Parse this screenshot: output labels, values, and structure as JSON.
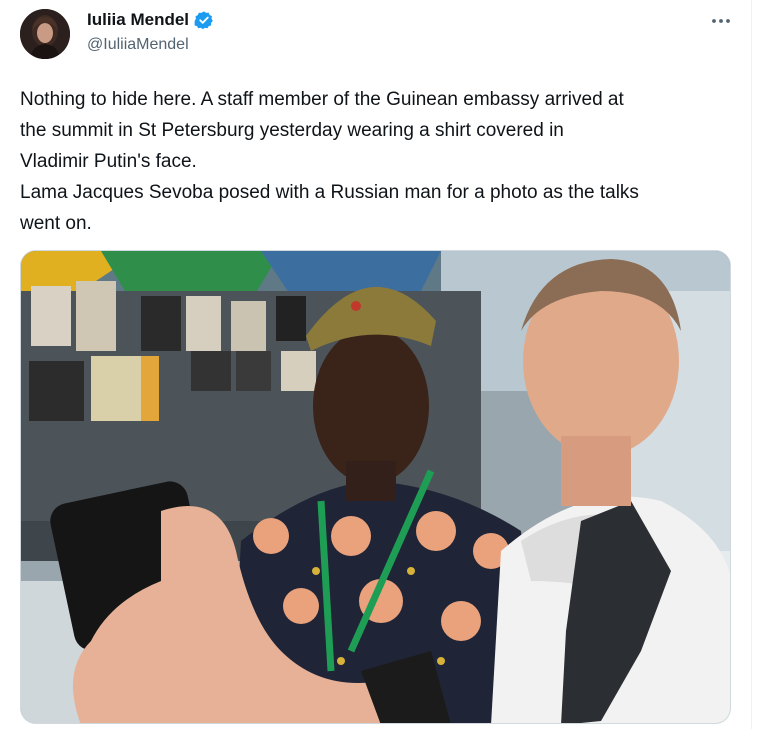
{
  "author": {
    "display_name": "Iuliia Mendel",
    "handle": "@IuliiaMendel",
    "verified": true,
    "avatar_icon": "profile-photo"
  },
  "more_icon": "more-horizontal-icon",
  "tweet": {
    "lines": [
      "Nothing to hide here. A staff member of the Guinean embassy arrived at",
      "the summit in St Petersburg yesterday wearing a shirt covered in",
      "Vladimir Putin's face.",
      "Lama Jacques Sevoba posed with a Russian man for a photo as the talks",
      "went on."
    ]
  },
  "media": {
    "type": "photo",
    "icon": "selfie-photo"
  },
  "colors": {
    "verified_blue": "#1d9bf0",
    "text": "#0f1419",
    "secondary": "#536471"
  }
}
